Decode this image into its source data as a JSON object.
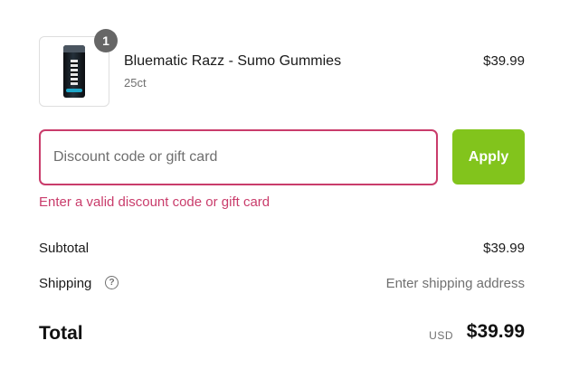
{
  "cart": {
    "items": [
      {
        "name": "Bluematic Razz - Sumo Gummies",
        "variant": "25ct",
        "price": "$39.99",
        "quantity": "1",
        "image_icon": "gummies-can-image"
      }
    ]
  },
  "discount": {
    "placeholder": "Discount code or gift card",
    "value": "",
    "apply_label": "Apply",
    "error": "Enter a valid discount code or gift card"
  },
  "summary": {
    "subtotal_label": "Subtotal",
    "subtotal_value": "$39.99",
    "shipping_label": "Shipping",
    "shipping_help_icon": "question-circle-icon",
    "shipping_value": "Enter shipping address",
    "total_label": "Total",
    "currency": "USD",
    "total_value": "$39.99"
  },
  "colors": {
    "error": "#c93c6b",
    "apply_button": "#82c41c",
    "badge": "#666666",
    "muted_text": "#707070"
  }
}
